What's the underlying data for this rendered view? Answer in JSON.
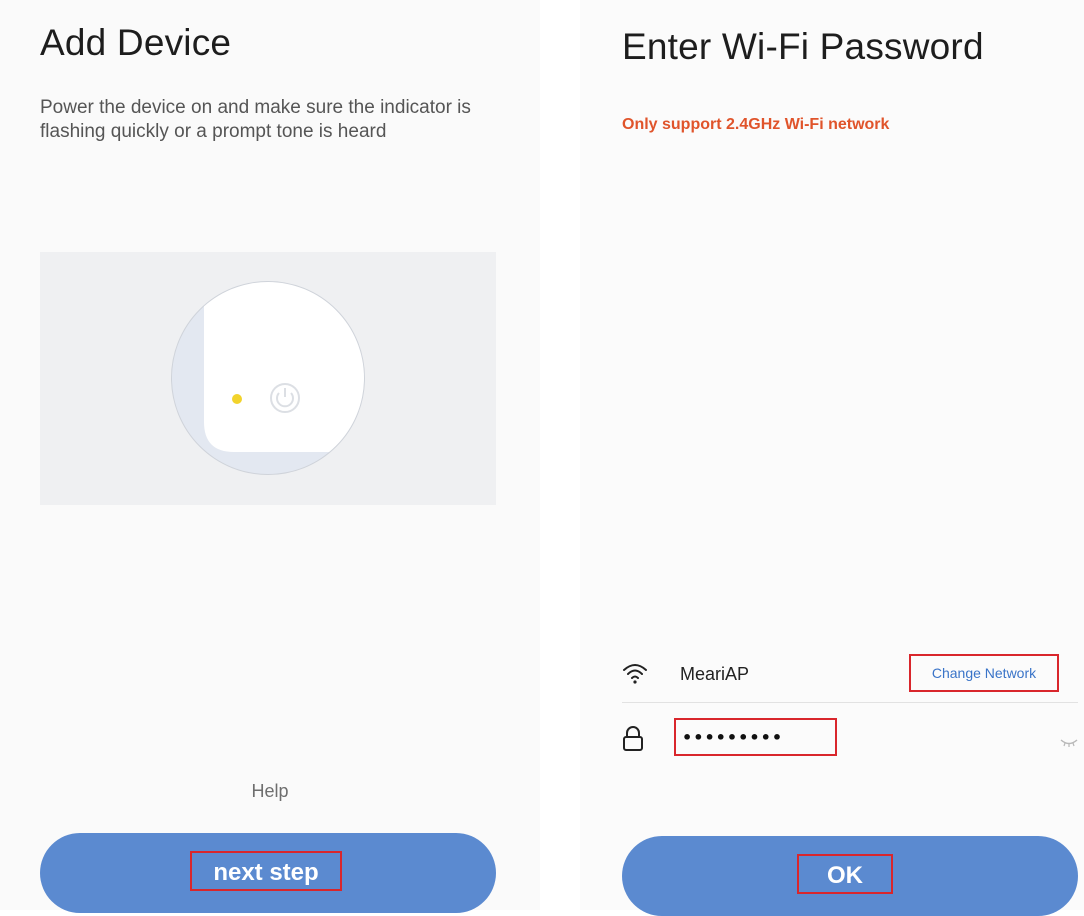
{
  "left_screen": {
    "title": "Add Device",
    "description": "Power the device on and make sure the indicator is flashing quickly or a prompt tone is heard",
    "help_label": "Help",
    "next_button_label": "next step",
    "indicator_color": "#f2d32c"
  },
  "right_screen": {
    "title": "Enter Wi-Fi Password",
    "warning": "Only support 2.4GHz Wi-Fi network",
    "network_name": "MeariAP",
    "change_network_label": "Change Network",
    "password_value": "•••••••••",
    "ok_button_label": "OK",
    "wifi_icon": "wifi-icon",
    "lock_icon": "lock-icon",
    "eye_icon": "eye-closed-icon"
  },
  "colors": {
    "accent": "#5b8ad0",
    "warning": "#e0542b",
    "highlight_box": "#d9262c",
    "link": "#3a74c8"
  }
}
